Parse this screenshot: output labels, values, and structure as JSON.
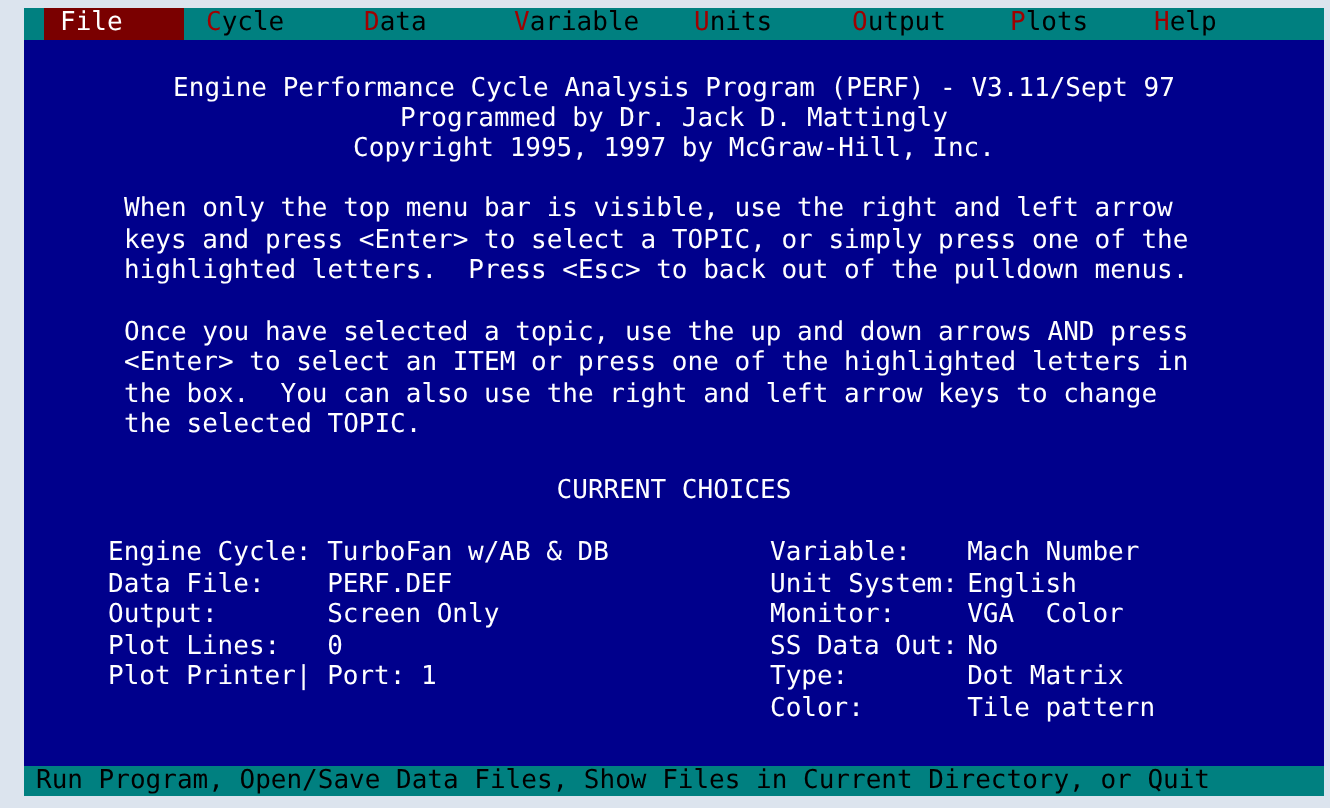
{
  "menu": [
    {
      "key": "F",
      "rest": "ile",
      "selected": true
    },
    {
      "key": "C",
      "rest": "ycle",
      "selected": false
    },
    {
      "key": "D",
      "rest": "ata",
      "selected": false
    },
    {
      "key": "V",
      "rest": "ariable",
      "selected": false
    },
    {
      "key": "U",
      "rest": "nits",
      "selected": false
    },
    {
      "key": "O",
      "rest": "utput",
      "selected": false
    },
    {
      "key": "P",
      "rest": "lots",
      "selected": false
    },
    {
      "key": "H",
      "rest": "elp",
      "selected": false
    }
  ],
  "title_lines": [
    "Engine Performance Cycle Analysis Program (PERF) - V3.11/Sept 97",
    "Programmed by Dr. Jack D. Mattingly",
    "Copyright 1995, 1997 by McGraw-Hill, Inc."
  ],
  "paragraphs": [
    [
      "When only the top menu bar is visible, use the right and left arrow",
      "keys and press <Enter> to select a TOPIC, or simply press one of the",
      "highlighted letters.  Press <Esc> to back out of the pulldown menus."
    ],
    [
      "Once you have selected a topic, use the up and down arrows AND press",
      "<Enter> to select an ITEM or press one of the highlighted letters in",
      "the box.  You can also use the right and left arrow keys to change",
      "the selected TOPIC."
    ]
  ],
  "choices_heading": "CURRENT CHOICES",
  "choices_left": [
    {
      "label": "Engine Cycle:",
      "value": "TurboFan w/AB & DB"
    },
    {
      "label": "Data File:",
      "value": "PERF.DEF"
    },
    {
      "label": "Output:",
      "value": "Screen Only"
    },
    {
      "label": "Plot Lines:",
      "value": "0"
    },
    {
      "label": "Plot Printer|",
      "value": "Port: 1"
    }
  ],
  "choices_right": [
    {
      "label": "Variable:",
      "value": "Mach Number"
    },
    {
      "label": "Unit System:",
      "value": "English"
    },
    {
      "label": "Monitor:",
      "value": "VGA  Color"
    },
    {
      "label": "SS Data Out:",
      "value": "No"
    },
    {
      "label": "Type:",
      "value": "Dot Matrix"
    },
    {
      "label": "Color:",
      "value": "Tile pattern"
    }
  ],
  "status_bar": "Run Program, Open/Save Data Files, Show Files in Current Directory, or Quit"
}
